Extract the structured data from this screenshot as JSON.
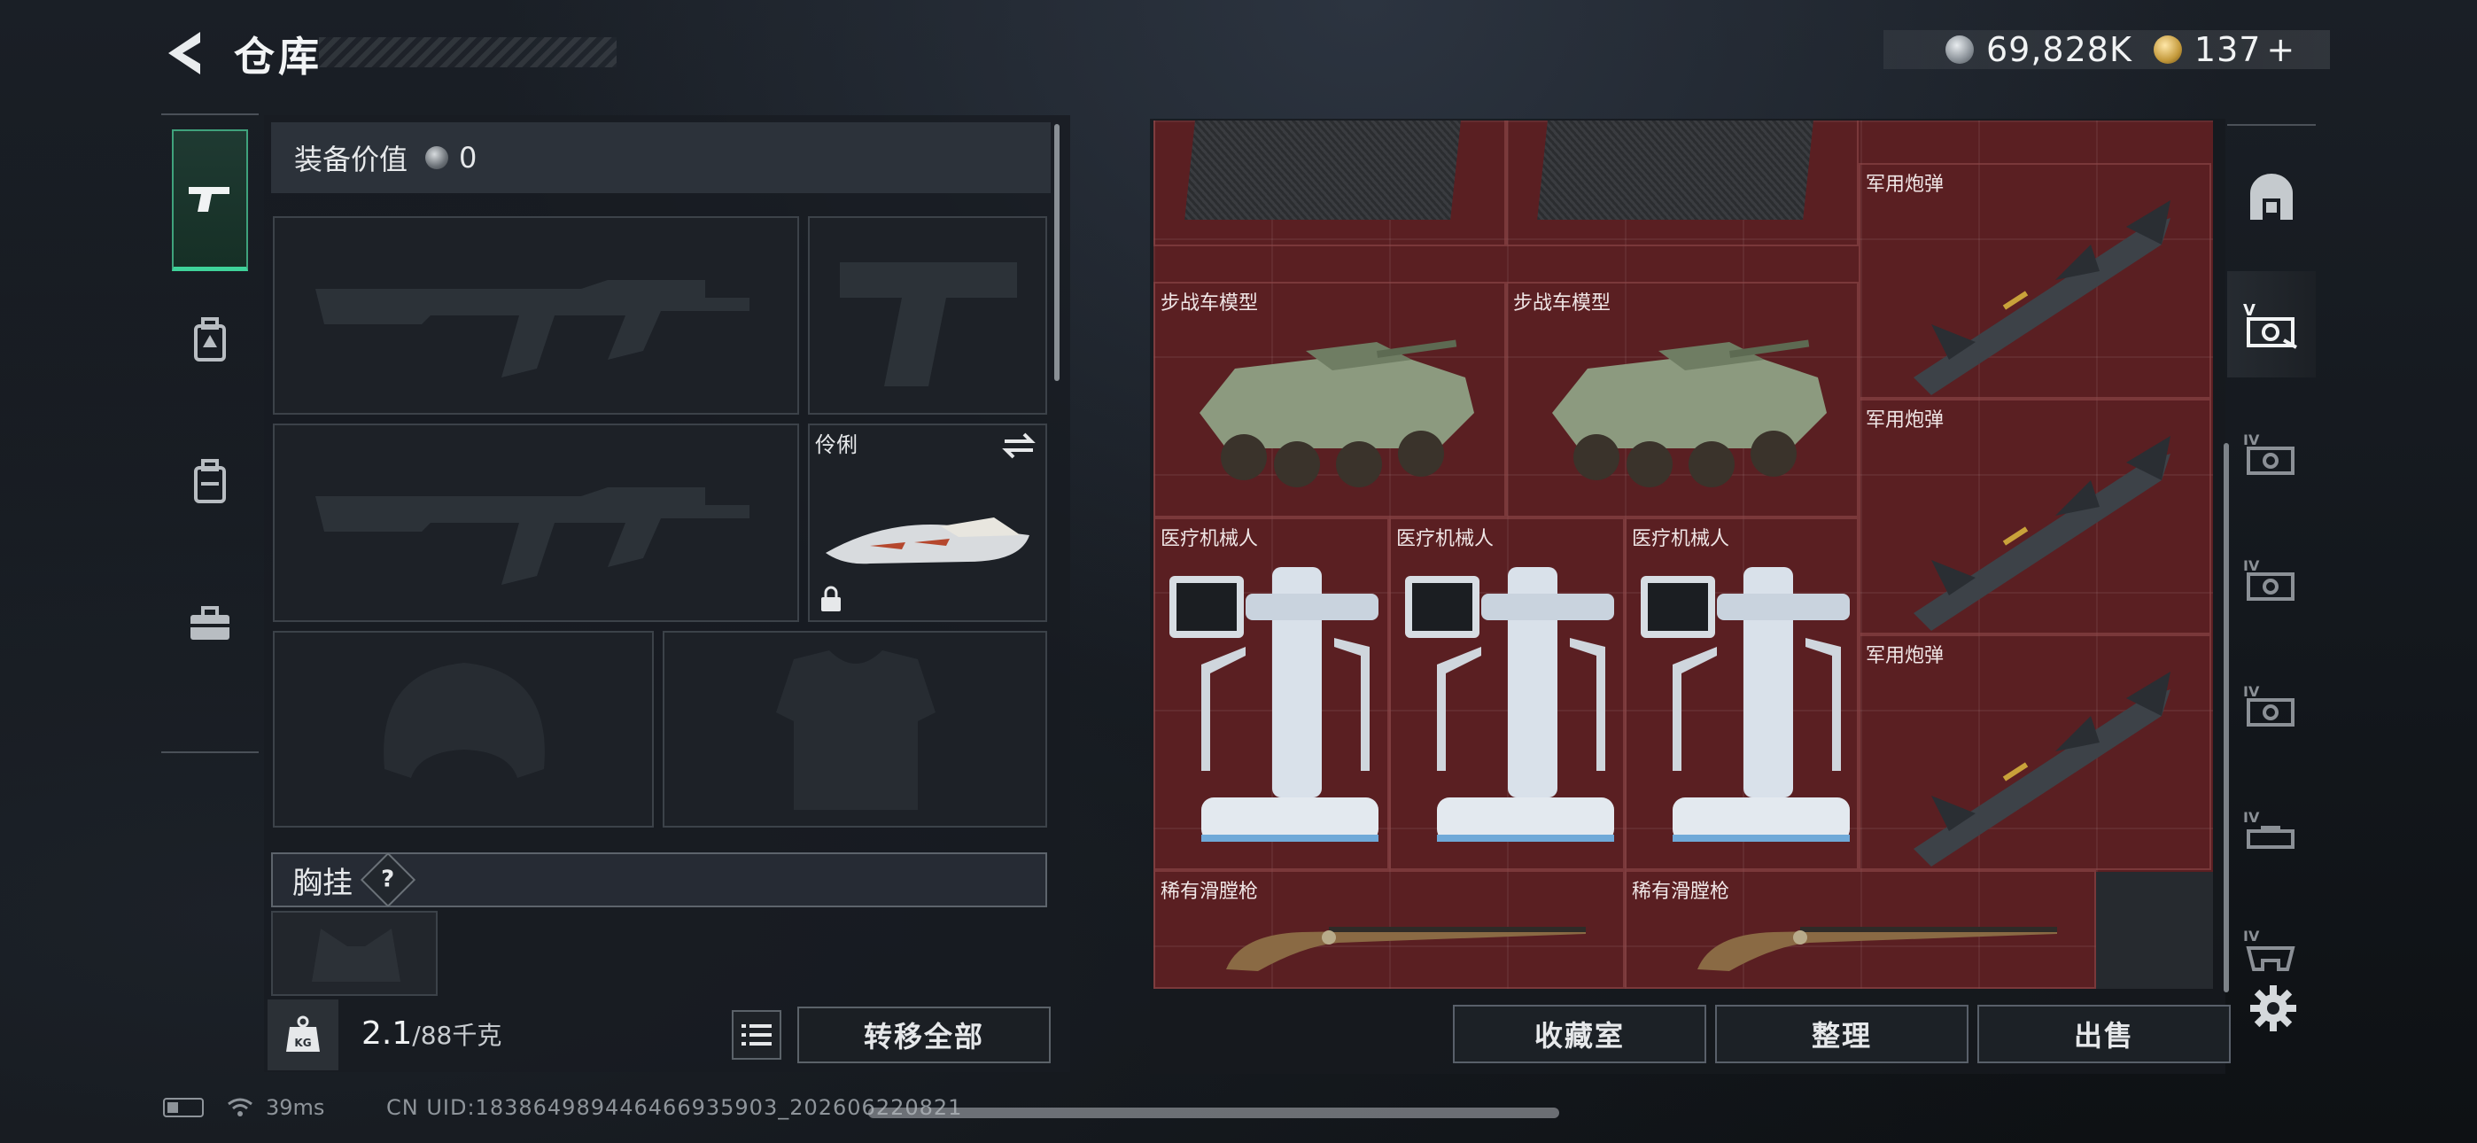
{
  "header": {
    "title": "仓库",
    "currency_1": "69,828K",
    "currency_2": "137",
    "currency_2_plus": "+",
    "icons": [
      "back-arrow-icon",
      "silver-coin-icon",
      "gold-coin-icon"
    ]
  },
  "left_tabs": [
    {
      "icon": "pistol-icon",
      "active": true
    },
    {
      "icon": "backpack-badge-icon",
      "active": false
    },
    {
      "icon": "backpack-icon",
      "active": false
    },
    {
      "icon": "toolbox-icon",
      "active": false
    }
  ],
  "equipment": {
    "value_label": "装备价值",
    "value": "0",
    "slots": [
      {
        "name": "primary-weapon-1",
        "label": ""
      },
      {
        "name": "pistol",
        "label": ""
      },
      {
        "name": "primary-weapon-2",
        "label": ""
      },
      {
        "name": "melee",
        "label": "伶俐"
      },
      {
        "name": "helmet",
        "label": ""
      },
      {
        "name": "armor",
        "label": ""
      }
    ],
    "chest_label": "胸挂",
    "chest_help": "?"
  },
  "bottom_left": {
    "weight_icon_text": "KG",
    "weight_current": "2.1",
    "weight_max": "/88千克",
    "transfer_all": "转移全部"
  },
  "storage": {
    "items": [
      {
        "label": "",
        "type": "plate"
      },
      {
        "label": "",
        "type": "plate"
      },
      {
        "label": "军用炮弹",
        "type": "missile"
      },
      {
        "label": "步战车模型",
        "type": "ifv"
      },
      {
        "label": "步战车模型",
        "type": "ifv"
      },
      {
        "label": "军用炮弹",
        "type": "missile"
      },
      {
        "label": "医疗机械人",
        "type": "robot"
      },
      {
        "label": "医疗机械人",
        "type": "robot"
      },
      {
        "label": "医疗机械人",
        "type": "robot"
      },
      {
        "label": "军用炮弹",
        "type": "missile"
      },
      {
        "label": "稀有滑膛枪",
        "type": "musket"
      },
      {
        "label": "稀有滑膛枪",
        "type": "musket"
      }
    ]
  },
  "actions": {
    "collection": "收藏室",
    "sort": "整理",
    "sell": "出售"
  },
  "right_tabs": [
    {
      "icon": "safe-box-icon"
    },
    {
      "icon": "case-v-icon",
      "active": true
    },
    {
      "icon": "case-iv-icon-1"
    },
    {
      "icon": "case-iv-icon-2"
    },
    {
      "icon": "case-iv-icon-3"
    },
    {
      "icon": "case-iv-icon-4"
    },
    {
      "icon": "case-iv-icon-5"
    }
  ],
  "status_bar": {
    "ping": "39ms",
    "uid": "CN UID:183864989446466935903_202606220821"
  },
  "colors": {
    "storage_bg": "#5a1f22",
    "active_tab_accent": "#3fd39a"
  }
}
